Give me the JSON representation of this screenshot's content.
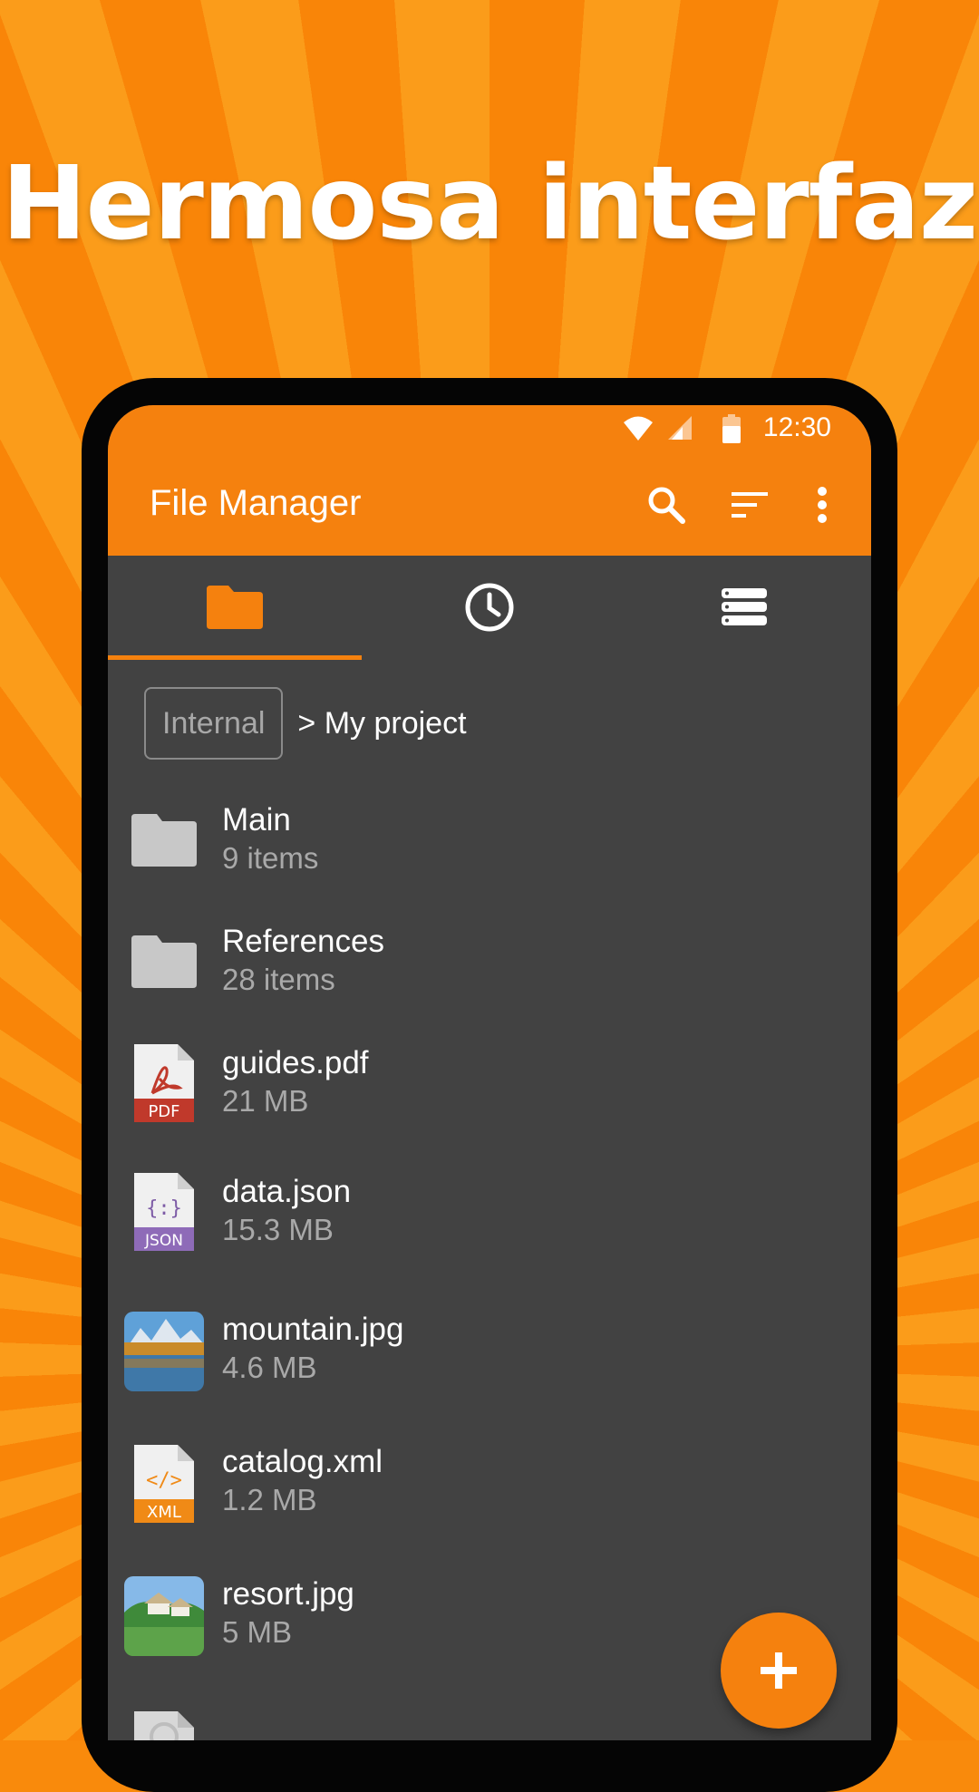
{
  "promo": {
    "headline": "Hermosa interfaz"
  },
  "status_bar": {
    "time": "12:30"
  },
  "app_bar": {
    "title": "File Manager"
  },
  "tabs": [
    {
      "icon": "folder-icon",
      "active": true
    },
    {
      "icon": "clock-icon",
      "active": false
    },
    {
      "icon": "storage-icon",
      "active": false
    }
  ],
  "breadcrumb": {
    "root": "Internal",
    "path": "> My project"
  },
  "files": [
    {
      "name": "Main",
      "detail": "9 items",
      "icon": "folder-icon"
    },
    {
      "name": "References",
      "detail": "28 items",
      "icon": "folder-icon"
    },
    {
      "name": "guides.pdf",
      "detail": "21 MB",
      "icon": "pdf-file-icon",
      "badge": "PDF"
    },
    {
      "name": "data.json",
      "detail": "15.3 MB",
      "icon": "json-file-icon",
      "badge": "JSON"
    },
    {
      "name": "mountain.jpg",
      "detail": "4.6 MB",
      "icon": "image-thumbnail"
    },
    {
      "name": "catalog.xml",
      "detail": "1.2 MB",
      "icon": "xml-file-icon",
      "badge": "XML"
    },
    {
      "name": "resort.jpg",
      "detail": "5 MB",
      "icon": "image-thumbnail"
    }
  ],
  "colors": {
    "accent": "#f5810e",
    "background": "#424242",
    "text_secondary": "#a9a9a9"
  }
}
